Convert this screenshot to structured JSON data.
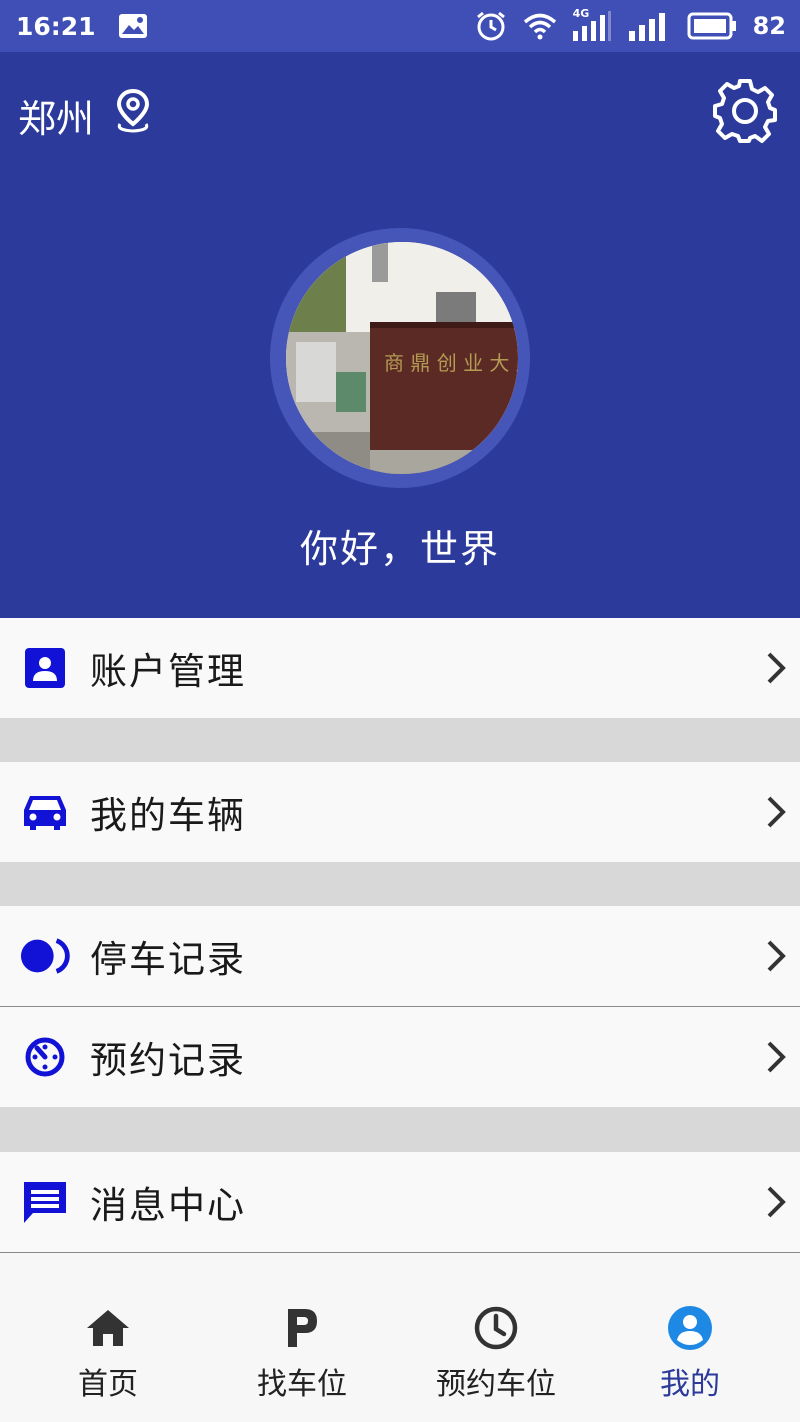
{
  "status_bar": {
    "time": "16:21",
    "battery": "82",
    "network": "4G"
  },
  "header": {
    "city": "郑州",
    "greeting": "你好，世界",
    "background_color": "#2b3a9b",
    "icons": {
      "location": "location-pin-icon",
      "settings": "gear-icon"
    }
  },
  "menu": {
    "items": [
      {
        "label": "账户管理",
        "icon": "account-card-icon"
      },
      {
        "label": "我的车辆",
        "icon": "car-icon"
      },
      {
        "label": "停车记录",
        "icon": "parking-record-icon"
      },
      {
        "label": "预约记录",
        "icon": "timer-icon"
      },
      {
        "label": "消息中心",
        "icon": "message-icon"
      }
    ],
    "icon_color": "#1212d6"
  },
  "bottom_nav": {
    "items": [
      {
        "label": "首页",
        "icon": "home-icon"
      },
      {
        "label": "找车位",
        "icon": "parking-p-icon"
      },
      {
        "label": "预约车位",
        "icon": "clock-icon"
      },
      {
        "label": "我的",
        "icon": "user-circle-icon",
        "active": true
      }
    ],
    "active_color": "#2b3a9b"
  }
}
